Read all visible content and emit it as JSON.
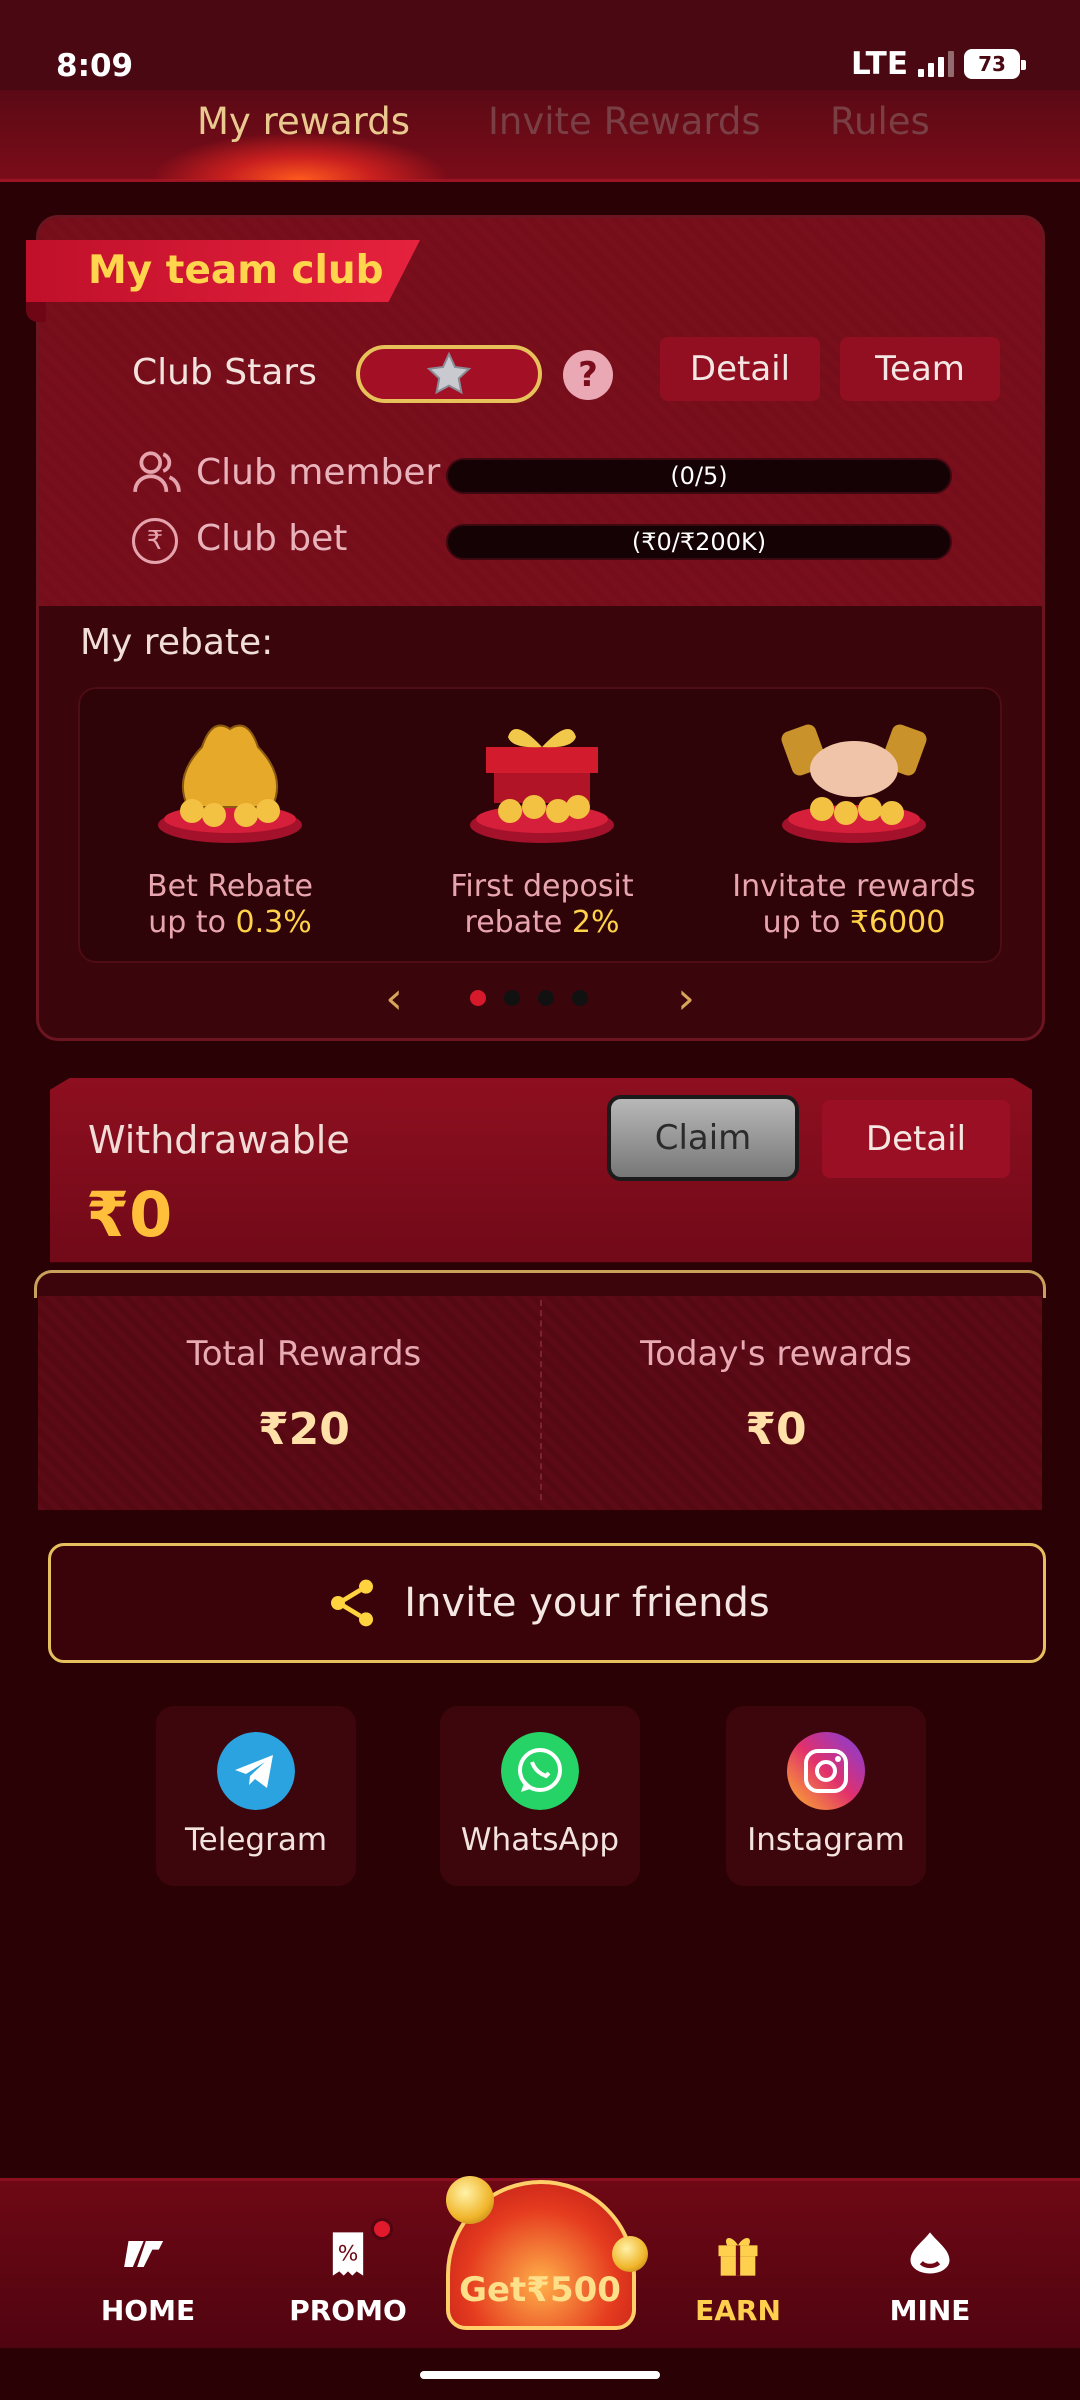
{
  "status": {
    "time": "8:09",
    "network": "LTE",
    "battery": "73"
  },
  "tabs": [
    {
      "label": "My rewards",
      "active": true
    },
    {
      "label": "Invite Rewards"
    },
    {
      "label": "Rules"
    }
  ],
  "team_club": {
    "title": "My team club",
    "club_stars_label": "Club Stars",
    "detail_label": "Detail",
    "team_label": "Team",
    "club_member_label": "Club member",
    "club_member_progress": "(0/5)",
    "club_bet_label": "Club bet",
    "club_bet_progress": "(₹0/₹200K)",
    "rebate_title": "My rebate:",
    "rebates": [
      {
        "line1": "Bet Rebate",
        "line2_prefix": "up to ",
        "highlight": "0.3%"
      },
      {
        "line1": "First deposit",
        "line2_prefix": "rebate ",
        "highlight": "2%"
      },
      {
        "line1": "Invitate rewards",
        "line2_prefix": "up to ",
        "highlight": "₹6000"
      }
    ],
    "carousel_active_index": 0
  },
  "withdrawable": {
    "label": "Withdrawable",
    "amount": "₹0",
    "claim_label": "Claim",
    "detail_label": "Detail"
  },
  "totals": {
    "total_label": "Total Rewards",
    "total_value": "₹20",
    "today_label": "Today's rewards",
    "today_value": "₹0"
  },
  "invite": {
    "label": "Invite your friends"
  },
  "share": [
    {
      "label": "Telegram",
      "icon": "telegram-icon",
      "color": "#2aa3e0"
    },
    {
      "label": "WhatsApp",
      "icon": "whatsapp-icon",
      "color": "#25d366"
    },
    {
      "label": "Instagram",
      "icon": "instagram-icon",
      "color": "#d6249f"
    }
  ],
  "nav": {
    "home": "HOME",
    "promo": "PROMO",
    "center": "Get₹500",
    "earn": "EARN",
    "mine": "MINE",
    "active": "EARN"
  }
}
